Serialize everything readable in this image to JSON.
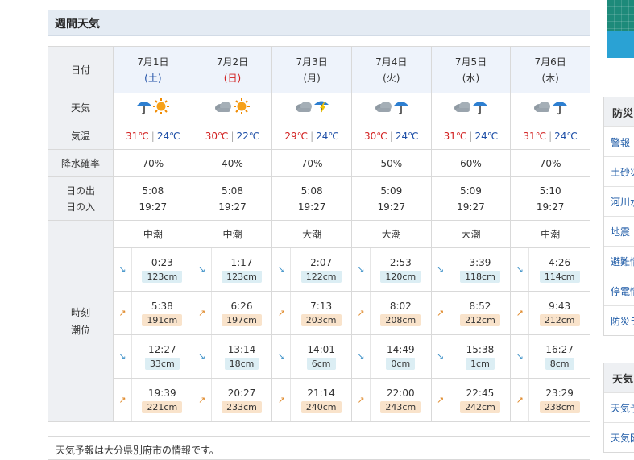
{
  "page_title": "週間天気",
  "row_labels": {
    "date": "日付",
    "weather": "天気",
    "temp": "気温",
    "rain": "降水確率",
    "sunrise": "日の出",
    "sunset": "日の入",
    "tide_time": "時刻",
    "tide_level": "潮位"
  },
  "temp_separator": "|",
  "days": [
    {
      "date": "7月1日",
      "dow": "(土)",
      "weather_icons": [
        "umbrella-icon",
        "sun-icon"
      ],
      "high": "31℃",
      "low": "24℃",
      "rain": "70%",
      "sunrise": "5:08",
      "sunset": "19:27",
      "tide_type": "中潮",
      "tides": [
        {
          "time": "0:23",
          "level": "123cm"
        },
        {
          "time": "5:38",
          "level": "191cm"
        },
        {
          "time": "12:27",
          "level": "33cm"
        },
        {
          "time": "19:39",
          "level": "221cm"
        }
      ]
    },
    {
      "date": "7月2日",
      "dow": "(日)",
      "weather_icons": [
        "cloud-icon",
        "sun-icon"
      ],
      "high": "30℃",
      "low": "22℃",
      "rain": "40%",
      "sunrise": "5:08",
      "sunset": "19:27",
      "tide_type": "中潮",
      "tides": [
        {
          "time": "1:17",
          "level": "123cm"
        },
        {
          "time": "6:26",
          "level": "197cm"
        },
        {
          "time": "13:14",
          "level": "18cm"
        },
        {
          "time": "20:27",
          "level": "233cm"
        }
      ]
    },
    {
      "date": "7月3日",
      "dow": "(月)",
      "weather_icons": [
        "cloud-icon",
        "thunder-rain-icon"
      ],
      "high": "29℃",
      "low": "24℃",
      "rain": "70%",
      "sunrise": "5:08",
      "sunset": "19:27",
      "tide_type": "大潮",
      "tides": [
        {
          "time": "2:07",
          "level": "122cm"
        },
        {
          "time": "7:13",
          "level": "203cm"
        },
        {
          "time": "14:01",
          "level": "6cm"
        },
        {
          "time": "21:14",
          "level": "240cm"
        }
      ]
    },
    {
      "date": "7月4日",
      "dow": "(火)",
      "weather_icons": [
        "cloud-icon",
        "umbrella-icon"
      ],
      "high": "30℃",
      "low": "24℃",
      "rain": "50%",
      "sunrise": "5:09",
      "sunset": "19:27",
      "tide_type": "大潮",
      "tides": [
        {
          "time": "2:53",
          "level": "120cm"
        },
        {
          "time": "8:02",
          "level": "208cm"
        },
        {
          "time": "14:49",
          "level": "0cm"
        },
        {
          "time": "22:00",
          "level": "243cm"
        }
      ]
    },
    {
      "date": "7月5日",
      "dow": "(水)",
      "weather_icons": [
        "cloud-icon",
        "umbrella-icon"
      ],
      "high": "31℃",
      "low": "24℃",
      "rain": "60%",
      "sunrise": "5:09",
      "sunset": "19:27",
      "tide_type": "大潮",
      "tides": [
        {
          "time": "3:39",
          "level": "118cm"
        },
        {
          "time": "8:52",
          "level": "212cm"
        },
        {
          "time": "15:38",
          "level": "1cm"
        },
        {
          "time": "22:45",
          "level": "242cm"
        }
      ]
    },
    {
      "date": "7月6日",
      "dow": "(木)",
      "weather_icons": [
        "cloud-icon",
        "umbrella-icon"
      ],
      "high": "31℃",
      "low": "24℃",
      "rain": "70%",
      "sunrise": "5:10",
      "sunset": "19:27",
      "tide_type": "中潮",
      "tides": [
        {
          "time": "4:26",
          "level": "114cm"
        },
        {
          "time": "9:43",
          "level": "212cm"
        },
        {
          "time": "16:27",
          "level": "8cm"
        },
        {
          "time": "23:29",
          "level": "238cm"
        }
      ]
    }
  ],
  "tide_directions": [
    "down",
    "up",
    "down",
    "up"
  ],
  "footer_note": "天気予報は大分県別府市の情報です。",
  "sidebar": {
    "section1_title": "防災",
    "section1_items": [
      "警報",
      "土砂災",
      "河川水",
      "地震",
      "避難情",
      "停電情",
      "防災ラ"
    ],
    "section2_title": "天気",
    "section2_items": [
      "天気予",
      "天気図"
    ]
  },
  "colors": {
    "saturday": "#1d4ea6",
    "sunday": "#d21f1f",
    "high_temp": "#d21f1f",
    "low_temp": "#1d4ea6",
    "low_tide_bg": "#dceef4",
    "high_tide_bg": "#f9e3cb"
  }
}
